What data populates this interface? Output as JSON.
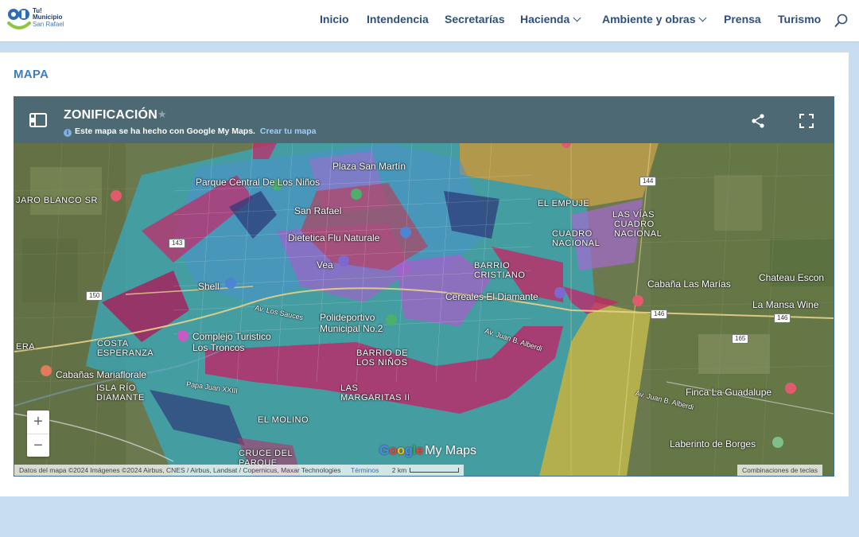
{
  "logo": {
    "line1": "Tu!",
    "line2": "Municipio",
    "line3": "San Rafael"
  },
  "nav": [
    {
      "label": "Inicio",
      "dropdown": false
    },
    {
      "label": "Intendencia",
      "dropdown": false
    },
    {
      "label": "Secretarías",
      "dropdown": false
    },
    {
      "label": "Hacienda",
      "dropdown": true
    },
    {
      "label": "Ambiente y obras",
      "dropdown": true
    },
    {
      "label": "Prensa",
      "dropdown": false
    },
    {
      "label": "Turismo",
      "dropdown": false
    }
  ],
  "page": {
    "title": "MAPA"
  },
  "map_embed": {
    "title": "ZONIFICACIÓN",
    "subtitle": "Este mapa se ha hecho con Google My Maps.",
    "create_link": "Crear tu mapa",
    "attribution": "Datos del mapa ©2024 Imágenes ©2024 Airbus, CNES / Airbus, Landsat / Copernicus, Maxar Technologies",
    "terms": "Términos",
    "scale": "2 km",
    "keyboard": "Combinaciones de teclas",
    "zoom_in": "+",
    "zoom_out": "−",
    "brand": {
      "g1": "G",
      "o1": "o",
      "o2": "o",
      "g2": "g",
      "l": "l",
      "e": "e",
      "my": "My Maps"
    }
  },
  "map_labels": [
    "Plaza San Martín",
    "Parque Central De Los Niños",
    "San Rafael",
    "Dietetica Flu Naturale",
    "Vea",
    "Shell",
    "Polideportivo Municipal No.2",
    "Cereales El Diamante",
    "Complejo Turistico Los Troncos",
    "Cabañas Mariaflorale",
    "Cabaña Las Marías",
    "Chateau Escon",
    "La Mansa Wine",
    "Finca La Guadalupe",
    "Laberinto de Borges",
    "JARO BLANCO SR",
    "EL EMPUJE",
    "LAS VÍAS",
    "CUADRO NACIONAL",
    "CUADRO NACIONAL",
    "BARRIO CRISTIANO",
    "COSTA ESPERANZA",
    "ISLA RÍO DIAMANTE",
    "BARRIO DE LOS NIÑOS",
    "LAS MARGARITAS II",
    "EL MOLINO",
    "CRUCE DEL PARQUE",
    "ERA"
  ],
  "road_labels": [
    "Av. Los Sauces",
    "Av. Juan B. Alberdi",
    "Papa Juan XXIII",
    "Av. Juan B. Alberdi"
  ],
  "route_shields": [
    "146",
    "146",
    "150",
    "165",
    "143",
    "144"
  ],
  "colors": {
    "nav_text": "#2f4f7a",
    "title_blue": "#3f7fb8",
    "bar": "#4d6974",
    "page_bg": "#c9ddf1"
  }
}
